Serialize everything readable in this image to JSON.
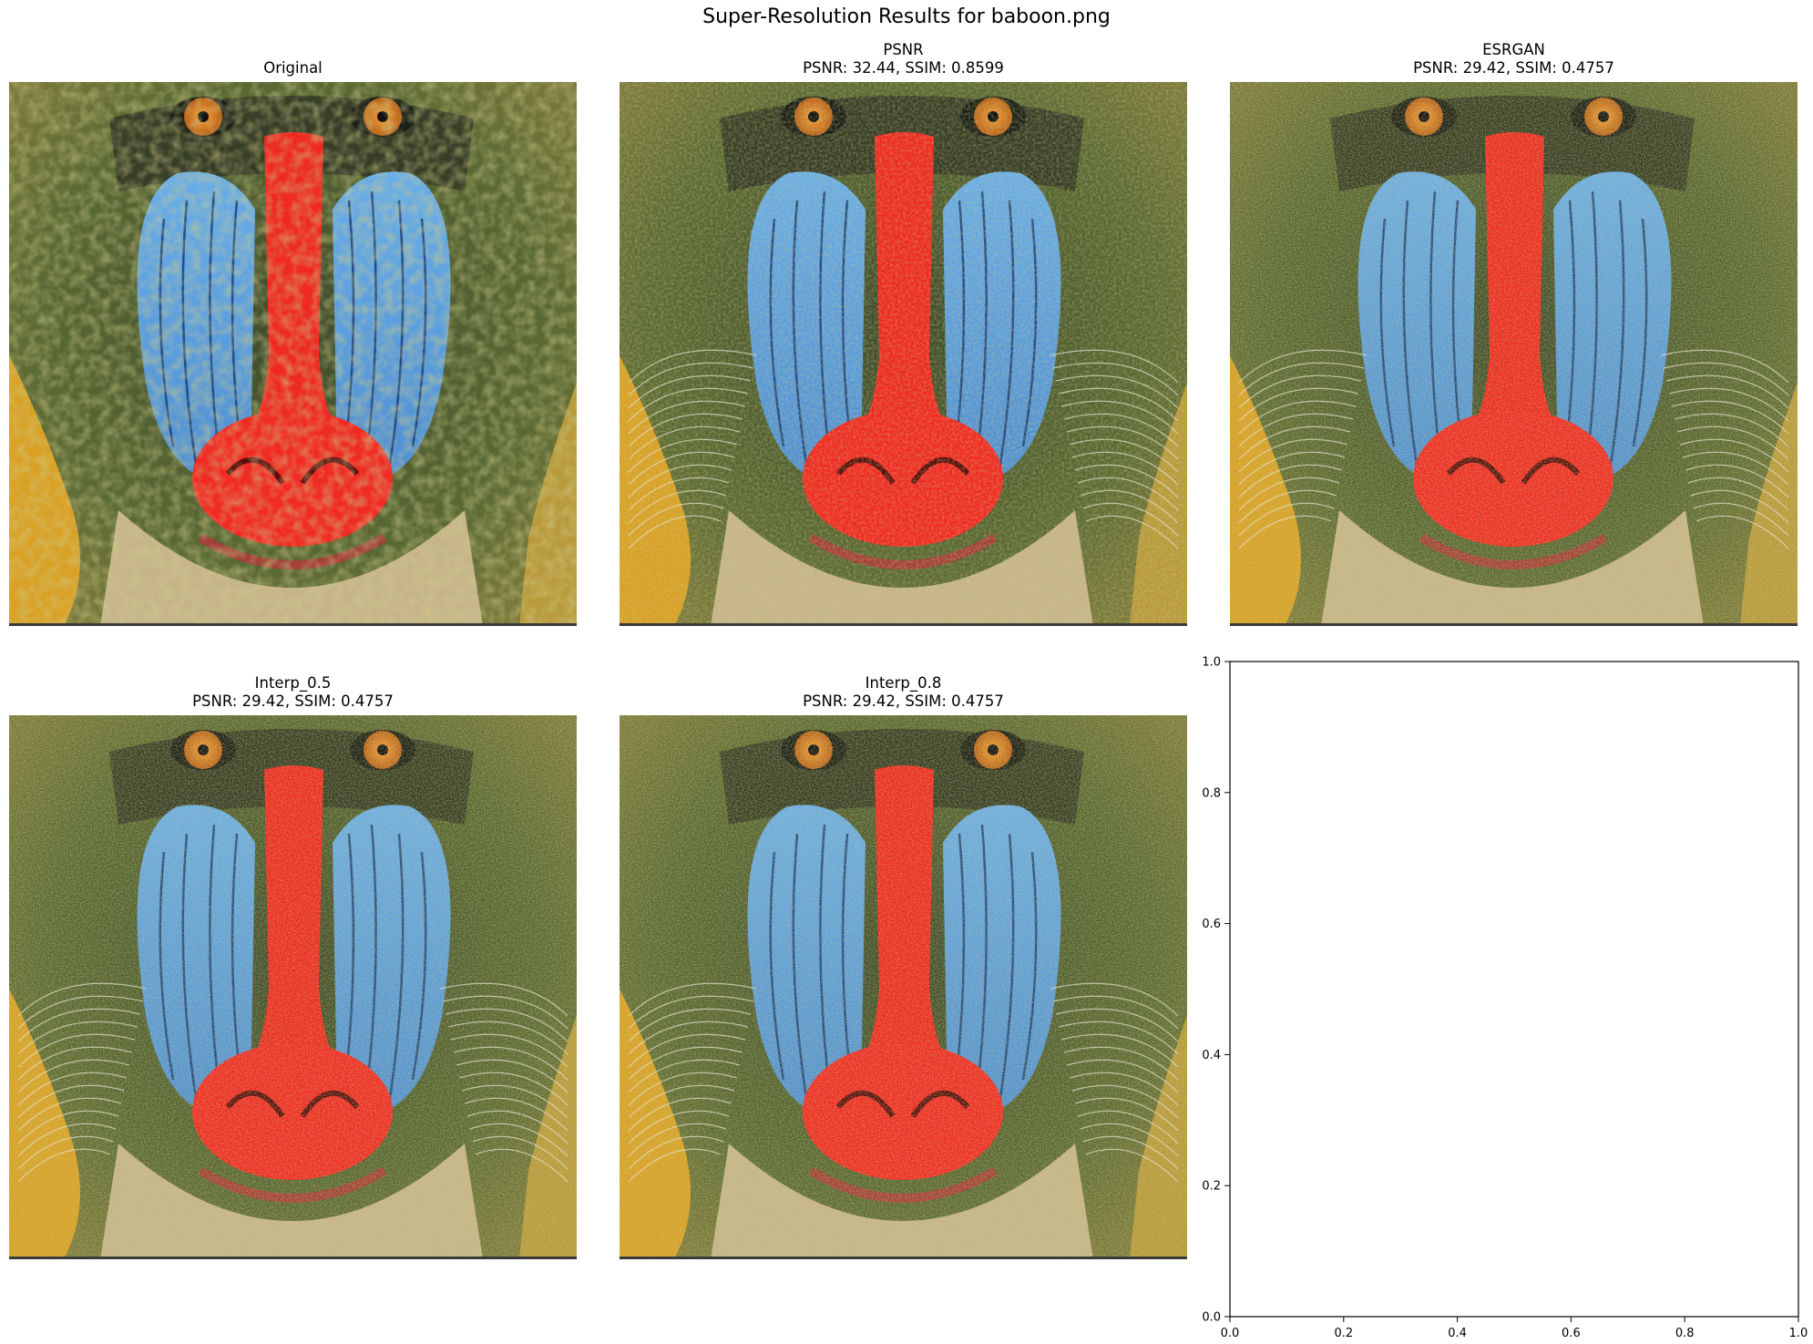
{
  "suptitle": "Super-Resolution Results for baboon.png",
  "panels": [
    {
      "title": "Original",
      "metrics": ""
    },
    {
      "title": "PSNR",
      "metrics": "PSNR: 32.44, SSIM: 0.8599"
    },
    {
      "title": "ESRGAN",
      "metrics": "PSNR: 29.42, SSIM: 0.4757"
    },
    {
      "title": "Interp_0.5",
      "metrics": "PSNR: 29.42, SSIM: 0.4757"
    },
    {
      "title": "Interp_0.8",
      "metrics": "PSNR: 29.42, SSIM: 0.4757"
    }
  ],
  "chart_data": {
    "type": "image-grid",
    "title": "Super-Resolution Results for baboon.png",
    "results": [
      {
        "method": "Original"
      },
      {
        "method": "PSNR",
        "psnr": 32.44,
        "ssim": 0.8599
      },
      {
        "method": "ESRGAN",
        "psnr": 29.42,
        "ssim": 0.4757
      },
      {
        "method": "Interp_0.5",
        "psnr": 29.42,
        "ssim": 0.4757
      },
      {
        "method": "Interp_0.8",
        "psnr": 29.42,
        "ssim": 0.4757
      }
    ],
    "empty_axes": {
      "xlim": [
        0.0,
        1.0
      ],
      "ylim": [
        0.0,
        1.0
      ],
      "xticks": [
        "0.0",
        "0.2",
        "0.4",
        "0.6",
        "0.8",
        "1.0"
      ],
      "yticks": [
        "0.0",
        "0.2",
        "0.4",
        "0.6",
        "0.8",
        "1.0"
      ],
      "grid": false
    }
  }
}
